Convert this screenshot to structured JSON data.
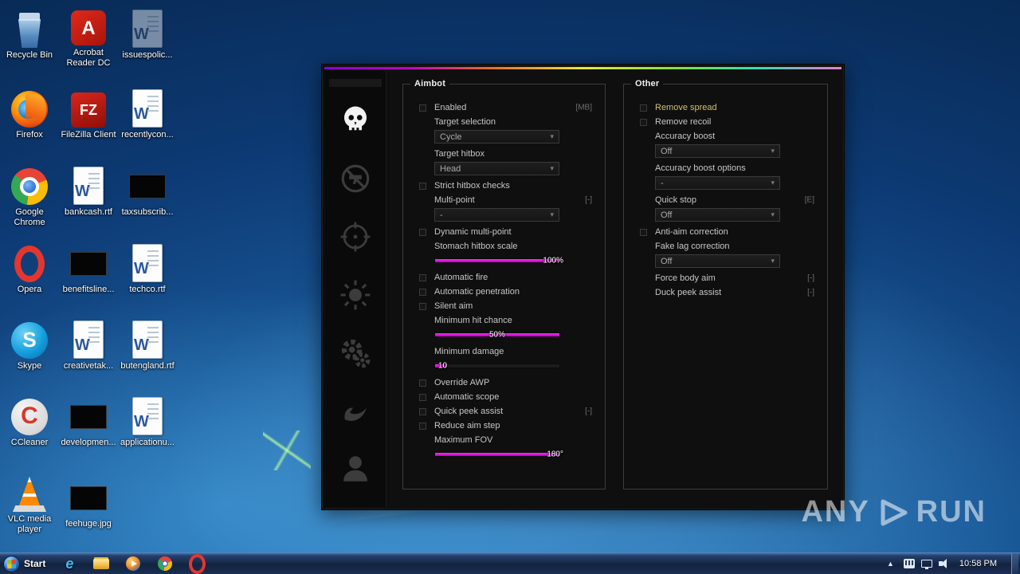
{
  "desktop": {
    "icons": [
      {
        "name": "recycle-bin",
        "label": "Recycle Bin"
      },
      {
        "name": "acrobat-reader",
        "label": "Acrobat Reader DC"
      },
      {
        "name": "issuespolic",
        "label": "issuespolic..."
      },
      {
        "name": "firefox",
        "label": "Firefox"
      },
      {
        "name": "filezilla",
        "label": "FileZilla Client"
      },
      {
        "name": "recentlycon",
        "label": "recentlycon..."
      },
      {
        "name": "google-chrome",
        "label": "Google Chrome"
      },
      {
        "name": "bankcash",
        "label": "bankcash.rtf"
      },
      {
        "name": "taxsubscrib",
        "label": "taxsubscrib..."
      },
      {
        "name": "opera",
        "label": "Opera"
      },
      {
        "name": "benefitsline",
        "label": "benefitsline..."
      },
      {
        "name": "techco",
        "label": "techco.rtf"
      },
      {
        "name": "skype",
        "label": "Skype"
      },
      {
        "name": "creativetak",
        "label": "creativetak..."
      },
      {
        "name": "butengland",
        "label": "butengland.rtf"
      },
      {
        "name": "ccleaner",
        "label": "CCleaner"
      },
      {
        "name": "developmen",
        "label": "developmen..."
      },
      {
        "name": "applicationu",
        "label": "applicationu..."
      },
      {
        "name": "vlc",
        "label": "VLC media player"
      },
      {
        "name": "feehuge",
        "label": "feehuge.jpg"
      }
    ]
  },
  "cheat": {
    "sidebar_tabs": [
      "aimbot",
      "triggerbot",
      "crosshair",
      "visuals",
      "settings",
      "misc",
      "profile"
    ],
    "aimbot": {
      "title": "Aimbot",
      "enabled_label": "Enabled",
      "enabled_hotkey": "[MB]",
      "target_selection_label": "Target selection",
      "target_selection_value": "Cycle",
      "target_hitbox_label": "Target hitbox",
      "target_hitbox_value": "Head",
      "strict_label": "Strict hitbox checks",
      "multipoint_label": "Multi-point",
      "multipoint_value": "-",
      "multipoint_hotkey": "[-]",
      "dynamic_label": "Dynamic multi-point",
      "stomach_label": "Stomach hitbox scale",
      "stomach_value": "100%",
      "autofire_label": "Automatic fire",
      "autopen_label": "Automatic penetration",
      "silent_label": "Silent aim",
      "minhit_label": "Minimum hit chance",
      "minhit_value": "50%",
      "mindmg_label": "Minimum damage",
      "mindmg_value": "10",
      "overrideawp_label": "Override AWP",
      "autoscope_label": "Automatic scope",
      "quickpeek_label": "Quick peek assist",
      "quickpeek_hotkey": "[-]",
      "reduceaim_label": "Reduce aim step",
      "maxfov_label": "Maximum FOV",
      "maxfov_value": "180°"
    },
    "other": {
      "title": "Other",
      "removespread_label": "Remove spread",
      "removerecoil_label": "Remove recoil",
      "accboost_label": "Accuracy boost",
      "accboost_value": "Off",
      "accopts_label": "Accuracy boost options",
      "accopts_value": "-",
      "quickstop_label": "Quick stop",
      "quickstop_value": "Off",
      "quickstop_hotkey": "[E]",
      "antiaim_label": "Anti-aim correction",
      "fakelag_label": "Fake lag correction",
      "fakelag_value": "Off",
      "forcebody_label": "Force body aim",
      "forcebody_hotkey": "[-]",
      "duckpeek_label": "Duck peek assist",
      "duckpeek_hotkey": "[-]"
    },
    "colors": {
      "accent_magenta": "#e600e6",
      "highlight_yellow": "#cfc06b"
    }
  },
  "taskbar": {
    "start_label": "Start",
    "time": "10:58 PM"
  },
  "watermark": {
    "left": "ANY",
    "right": "RUN"
  }
}
